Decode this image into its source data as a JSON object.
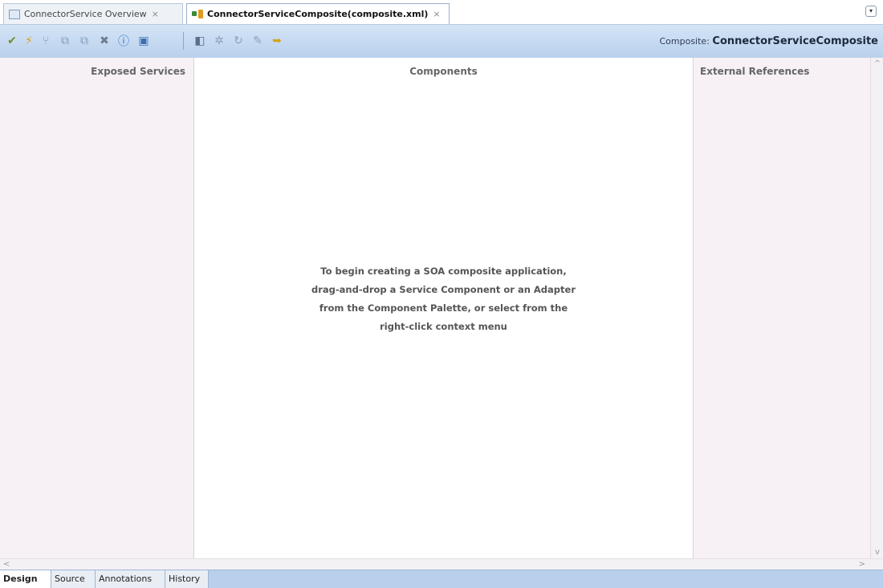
{
  "tabs": [
    {
      "label": "ConnectorService Overview",
      "close": "×"
    },
    {
      "label": "ConnectorServiceComposite(composite.xml)",
      "close": "×"
    }
  ],
  "menu_glyph": "▾",
  "toolbar": {
    "icons": [
      {
        "name": "validate-icon",
        "glyph": "✔",
        "color": "#6f8f2f"
      },
      {
        "name": "lightning-icon",
        "glyph": "⚡",
        "color": "#d7a417"
      },
      {
        "name": "wire-icon",
        "glyph": "⑂",
        "color": "#7f9bbd"
      },
      {
        "name": "copy-icon",
        "glyph": "⧉",
        "color": "#7f9bbd"
      },
      {
        "name": "paste-icon",
        "glyph": "⧉",
        "color": "#7f9bbd"
      },
      {
        "name": "delete-icon",
        "glyph": "✖",
        "color": "#6d7d91"
      },
      {
        "name": "info-icon",
        "glyph": "ⓘ",
        "color": "#2f6fbf"
      },
      {
        "name": "test-icon",
        "glyph": "▣",
        "color": "#3b6fb0"
      },
      {
        "name": "deploy-icon",
        "glyph": "◧",
        "color": "#5a6f8a"
      },
      {
        "name": "zoom-icon",
        "glyph": "✲",
        "color": "#8aa0bb"
      },
      {
        "name": "refresh-icon",
        "glyph": "↻",
        "color": "#8aa0bb"
      },
      {
        "name": "edit-icon",
        "glyph": "✎",
        "color": "#8aa0bb"
      },
      {
        "name": "run-icon",
        "glyph": "➥",
        "color": "#d7a417"
      }
    ],
    "composite_prefix": "Composite:",
    "composite_name": "ConnectorServiceComposite"
  },
  "panels": {
    "left_title": "Exposed Services",
    "center_title": "Components",
    "right_title": "External References",
    "hint_lines": [
      "To begin creating a SOA composite application,",
      "drag-and-drop a Service Component or an Adapter",
      "from the Component Palette, or select from the",
      "right-click context menu"
    ]
  },
  "scroll": {
    "up": "^",
    "down": "v",
    "left": "<",
    "right": ">"
  },
  "bottom_tabs": [
    "Design",
    "Source",
    "Annotations",
    "History"
  ]
}
